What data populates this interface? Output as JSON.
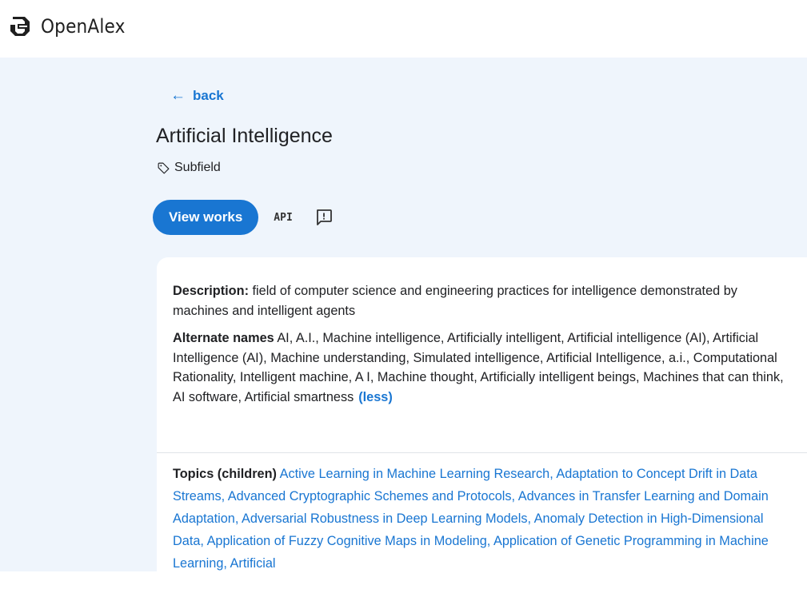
{
  "header": {
    "logo_text": "OpenAlex"
  },
  "nav": {
    "back_label": "back"
  },
  "entity": {
    "title": "Artificial Intelligence",
    "type_label": "Subfield"
  },
  "actions": {
    "view_works_label": "View works",
    "api_label": "API"
  },
  "details": {
    "description_label": "Description:",
    "description_text": "field of computer science and engineering practices for intelligence demonstrated by machines and intelligent agents",
    "alternate_names_label": "Alternate names",
    "alternate_names": [
      "AI",
      "A.I.",
      "Machine intelligence",
      "Artificially intelligent",
      "Artificial intelligence (AI)",
      "Artificial Intelligence (AI)",
      "Machine understanding",
      "Simulated intelligence",
      "Artificial Intelligence, a.i.",
      "Computational Rationality",
      "Intelligent machine",
      "A I",
      "Machine thought",
      "Artificially intelligent beings",
      "Machines that can think",
      "AI software",
      "Artificial smartness"
    ],
    "less_label": "(less)"
  },
  "topics": {
    "label": "Topics (children)",
    "items": [
      "Active Learning in Machine Learning Research",
      "Adaptation to Concept Drift in Data Streams",
      "Advanced Cryptographic Schemes and Protocols",
      "Advances in Transfer Learning and Domain Adaptation",
      "Adversarial Robustness in Deep Learning Models",
      "Anomaly Detection in High-Dimensional Data",
      "Application of Fuzzy Cognitive Maps in Modeling",
      "Application of Genetic Programming in Machine Learning",
      "Artificial"
    ]
  },
  "colors": {
    "accent": "#1976d2",
    "page_background": "#eff5fc",
    "card_background": "#ffffff"
  },
  "icons": {
    "logo": "openalex-logo-icon",
    "back": "arrow-left-icon",
    "type": "tag-icon",
    "feedback": "feedback-icon"
  }
}
